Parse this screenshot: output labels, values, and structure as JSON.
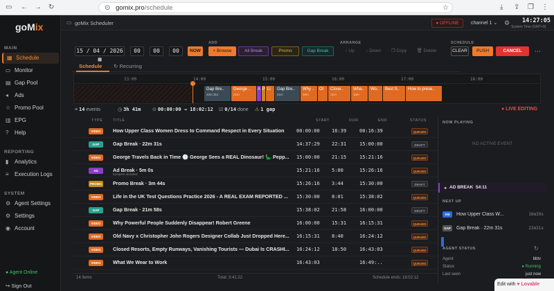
{
  "browser": {
    "url_host": "gomix.pro",
    "url_path": "/schedule"
  },
  "sidebar": {
    "logo_text": "goMix",
    "sections": {
      "main": "MAIN",
      "reporting": "REPORTING",
      "system": "SYSTEM"
    },
    "items": [
      {
        "label": "Schedule",
        "icon": "calendar-icon"
      },
      {
        "label": "Monitor",
        "icon": "monitor-icon"
      },
      {
        "label": "Gap Pool",
        "icon": "folder-icon"
      },
      {
        "label": "Ads",
        "icon": "megaphone-icon"
      },
      {
        "label": "Promo Pool",
        "icon": "star-icon"
      },
      {
        "label": "EPG",
        "icon": "guide-icon"
      },
      {
        "label": "Help",
        "icon": "help-icon"
      },
      {
        "label": "Analytics",
        "icon": "chart-icon"
      },
      {
        "label": "Execution Logs",
        "icon": "log-icon"
      },
      {
        "label": "Agent Settings",
        "icon": "gear-icon"
      },
      {
        "label": "Settings",
        "icon": "gear-icon"
      },
      {
        "label": "Account",
        "icon": "user-icon"
      }
    ],
    "agent_online": "Agent Online",
    "sign_out": "Sign Out"
  },
  "topbar": {
    "title": "goMix Scheduler",
    "status": "OFFLINE",
    "channel": "channel 1",
    "clock": "14:27:05",
    "clock_sub": "System Time (GMT+0)"
  },
  "toolbar": {
    "labels": {
      "add": "ADD",
      "arrange": "ARRANGE",
      "schedule": "SCHEDULE"
    },
    "date": "15 / 04 / 2026",
    "time_h": "00",
    "time_m": "00",
    "time_s": "00",
    "now": "NOW",
    "browse": "+ Browse",
    "ad_break": "All Break",
    "promo": "Promo",
    "gap_break": "Gap Break",
    "up": "Up",
    "down": "Down",
    "copy": "Copy",
    "delete": "Delete",
    "clear": "CLEAR",
    "push": "PUSH",
    "cancel": "CANCEL"
  },
  "tabs": {
    "schedule": "Schedule",
    "recurring": "Recurring"
  },
  "timeline": {
    "ticks": [
      "13:00",
      "14:00",
      "15:00",
      "16:00",
      "17:00",
      "18:00"
    ],
    "blocks": [
      {
        "t": "Gap Bre..",
        "s": "22m 31s",
        "k": "gap"
      },
      {
        "t": "George ..",
        "s": "21m",
        "k": "video"
      },
      {
        "t": "A",
        "s": "",
        "k": "ad"
      },
      {
        "t": "P",
        "s": "",
        "k": "promo"
      },
      {
        "t": "Li",
        "s": "",
        "k": "video"
      },
      {
        "t": "Gap Bre..",
        "s": "21m",
        "k": "gap"
      },
      {
        "t": "Why ..",
        "s": "15m",
        "k": "video"
      },
      {
        "t": "Ol",
        "s": "",
        "k": "video"
      },
      {
        "t": "Close..",
        "s": "21m",
        "k": "video"
      },
      {
        "t": "Wha..",
        "s": "15m",
        "k": "video"
      },
      {
        "t": "Wo..",
        "s": "",
        "k": "video"
      },
      {
        "t": "Best S..",
        "s": "",
        "k": "video"
      },
      {
        "t": "How to prese..",
        "s": "",
        "k": "video"
      }
    ]
  },
  "stats": {
    "events": "14",
    "events_label": "events",
    "duration": "3h 41m",
    "range": "00:00:00 → 18:02:12",
    "done": "0/14",
    "done_label": "done",
    "gap": "1 gap",
    "live": "● LIVE EDITING"
  },
  "table": {
    "headers": {
      "type": "TYPE",
      "title": "TITLE",
      "start": "START",
      "dur": "DUR",
      "end": "END",
      "status": "STATUS"
    },
    "rows": [
      {
        "type": "VIDEO",
        "k": "video",
        "title": "How Upper Class Women Dress to Command Respect in Every Situation",
        "sub": "",
        "start": "00:00:00",
        "dur": "16:39",
        "end": "00:16:39",
        "status": "QUEUED"
      },
      {
        "type": "GAP",
        "k": "gap",
        "title": "Gap Break · 22m 31s",
        "sub": "",
        "start": "14:37:29",
        "dur": "22:31",
        "end": "15:00:00",
        "status": "DRAFT"
      },
      {
        "type": "VIDEO",
        "k": "video",
        "title": "George Travels Back in Time 🕒 George Sees a REAL Dinosaur! 🦕 Pepp...",
        "sub": "",
        "start": "15:00:00",
        "dur": "21:15",
        "end": "15:21:16",
        "status": "QUEUED"
      },
      {
        "type": "AD",
        "k": "ad",
        "title": "Ad Break · 5m 0s",
        "sub": "bumpers included",
        "start": "15:21:16",
        "dur": "5:00",
        "end": "15:26:16",
        "status": "QUEUED"
      },
      {
        "type": "PROMO",
        "k": "promo",
        "title": "Promo Break · 3m 44s",
        "sub": "",
        "start": "15:26:16",
        "dur": "3:44",
        "end": "15:30:00",
        "status": "DRAFT"
      },
      {
        "type": "VIDEO",
        "k": "video",
        "title": "Life in the UK Test Questions Practice 2026 - A REAL EXAM REPORTED ...",
        "sub": "",
        "start": "15:30:00",
        "dur": "8:01",
        "end": "15:38:02",
        "status": "QUEUED"
      },
      {
        "type": "GAP",
        "k": "gap",
        "title": "Gap Break · 21m 58s",
        "sub": "",
        "start": "15:38:02",
        "dur": "21:58",
        "end": "16:00:00",
        "status": "DRAFT"
      },
      {
        "type": "VIDEO",
        "k": "video",
        "title": "Why Powerful People Suddenly Disappear! Robert Greene",
        "sub": "",
        "start": "16:00:00",
        "dur": "15:31",
        "end": "16:15:31",
        "status": "QUEUED"
      },
      {
        "type": "VIDEO",
        "k": "video",
        "title": "Old Navy x Christopher John Rogers Designer Collab Just Dropped Here...",
        "sub": "",
        "start": "16:15:31",
        "dur": "8:40",
        "end": "16:24:12",
        "status": "QUEUED"
      },
      {
        "type": "VIDEO",
        "k": "video",
        "title": "Closed Resorts, Empty Runways, Vanishing Tourists — Dubai Is CRASHI...",
        "sub": "",
        "start": "16:24:12",
        "dur": "18:50",
        "end": "16:43:03",
        "status": "QUEUED"
      },
      {
        "type": "VIDEO",
        "k": "video",
        "title": "What We Wear to Work",
        "sub": "",
        "start": "16:43:03",
        "dur": "",
        "end": "16:49:..",
        "status": "QUEUED"
      }
    ],
    "footer_items": "14 items",
    "footer_total": "Total: 3:41:22",
    "footer_ends": "Schedule ends: 18:02:12"
  },
  "right": {
    "now_playing": "NOW PLAYING",
    "no_active": "NO ACTIVE EVENT",
    "ad_break": "AD BREAK",
    "ad_break_time": "54:11",
    "next_up": "NEXT UP",
    "next": [
      {
        "badge": "VID",
        "k": "video",
        "title": "How Upper Class W...",
        "dur": "16m39s"
      },
      {
        "badge": "GAP",
        "k": "gap",
        "title": "Gap Break · 22m 31s",
        "dur": "22m31s"
      }
    ],
    "agent_status": "AGENT STATUS",
    "agent": {
      "k1": "Agent",
      "v1": "bbtv",
      "k2": "Status",
      "v2": "● Running",
      "k3": "Last seen",
      "v3": "just now"
    }
  },
  "badge": {
    "edit_with": "Edit with",
    "brand": "♥ Lovable"
  },
  "colors": {
    "accent": "#f07a2a",
    "video": "#e06a22",
    "gap": "#2aa090",
    "ad": "#8a3ec8",
    "promo": "#c08a1a",
    "danger": "#e0352f"
  }
}
